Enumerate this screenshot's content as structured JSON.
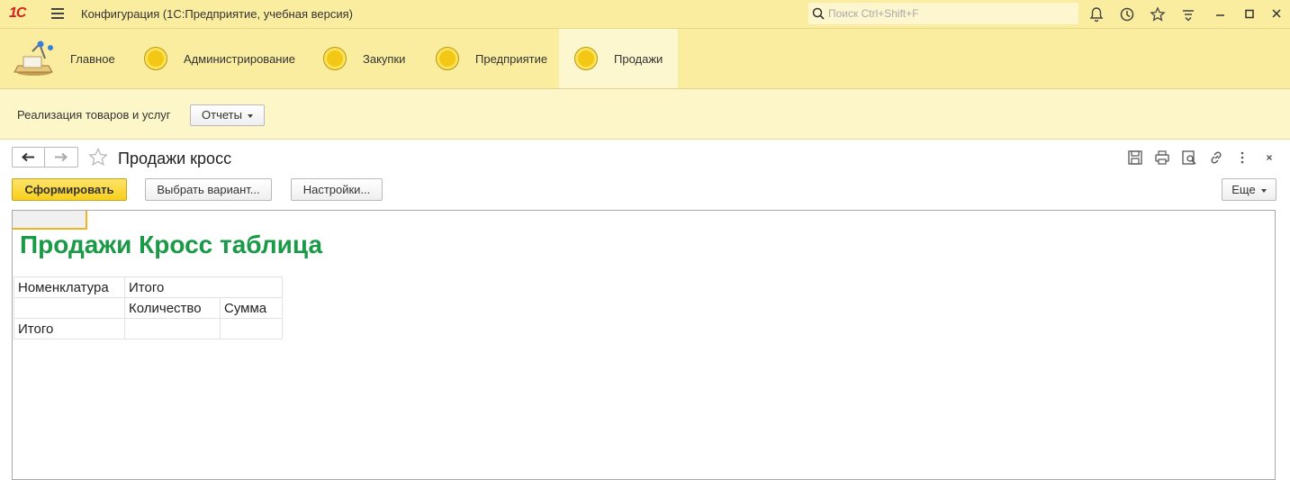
{
  "window": {
    "logo": "1С",
    "title": "Конфигурация  (1С:Предприятие, учебная версия)",
    "search_placeholder": "Поиск Ctrl+Shift+F"
  },
  "sections": [
    {
      "label": "Главное",
      "icon": "home-desk-icon"
    },
    {
      "label": "Администрирование",
      "icon": "section-coin-icon"
    },
    {
      "label": "Закупки",
      "icon": "section-coin-icon"
    },
    {
      "label": "Предприятие",
      "icon": "section-coin-icon"
    },
    {
      "label": "Продажи",
      "icon": "section-coin-icon",
      "active": true
    }
  ],
  "subbar": {
    "link": "Реализация товаров и услуг",
    "reports_button": "Отчеты"
  },
  "form": {
    "title": "Продажи кросс",
    "generate_button": "Сформировать",
    "variant_button": "Выбрать вариант...",
    "settings_button": "Настройки...",
    "more_button": "Еще"
  },
  "report": {
    "title": "Продажи Кросс таблица",
    "header_row1": [
      "Номенклатура",
      "Итого"
    ],
    "header_row2": [
      "Количество",
      "Сумма"
    ],
    "total_row": [
      "Итого",
      "",
      ""
    ]
  },
  "colors": {
    "panel_yellow": "#fbeda0",
    "accent_button": "#f7cf1a",
    "report_title": "#1a9a46"
  }
}
